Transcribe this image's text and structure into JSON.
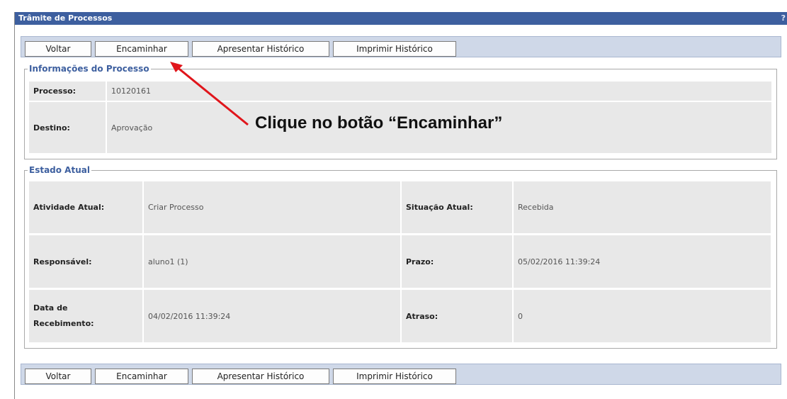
{
  "window": {
    "title": "Trâmite de Processos",
    "help": "?"
  },
  "toolbar_top": {
    "voltar": "Voltar",
    "encaminhar": "Encaminhar",
    "apresentar": "Apresentar Histórico",
    "imprimir": "Imprimir Histórico"
  },
  "toolbar_bottom": {
    "voltar": "Voltar",
    "encaminhar": "Encaminhar",
    "apresentar": "Apresentar Histórico",
    "imprimir": "Imprimir Histórico"
  },
  "info": {
    "legend": "Informações do Processo",
    "processo_label": "Processo:",
    "processo_value": "10120161",
    "destino_label": "Destino:",
    "destino_value": "Aprovação"
  },
  "estado": {
    "legend": "Estado Atual",
    "atividade_label": "Atividade Atual:",
    "atividade_value": "Criar Processo",
    "situacao_label": "Situação Atual:",
    "situacao_value": "Recebida",
    "responsavel_label": "Responsável:",
    "responsavel_value": "aluno1 (1)",
    "prazo_label": "Prazo:",
    "prazo_value": "05/02/2016 11:39:24",
    "recebimento_label_1": "Data de",
    "recebimento_label_2": "Recebimento:",
    "recebimento_value": "04/02/2016 11:39:24",
    "atraso_label": "Atraso:",
    "atraso_value": "0"
  },
  "annotation": {
    "text": "Clique no botão “Encaminhar”",
    "arrow_color": "#e0151b"
  }
}
